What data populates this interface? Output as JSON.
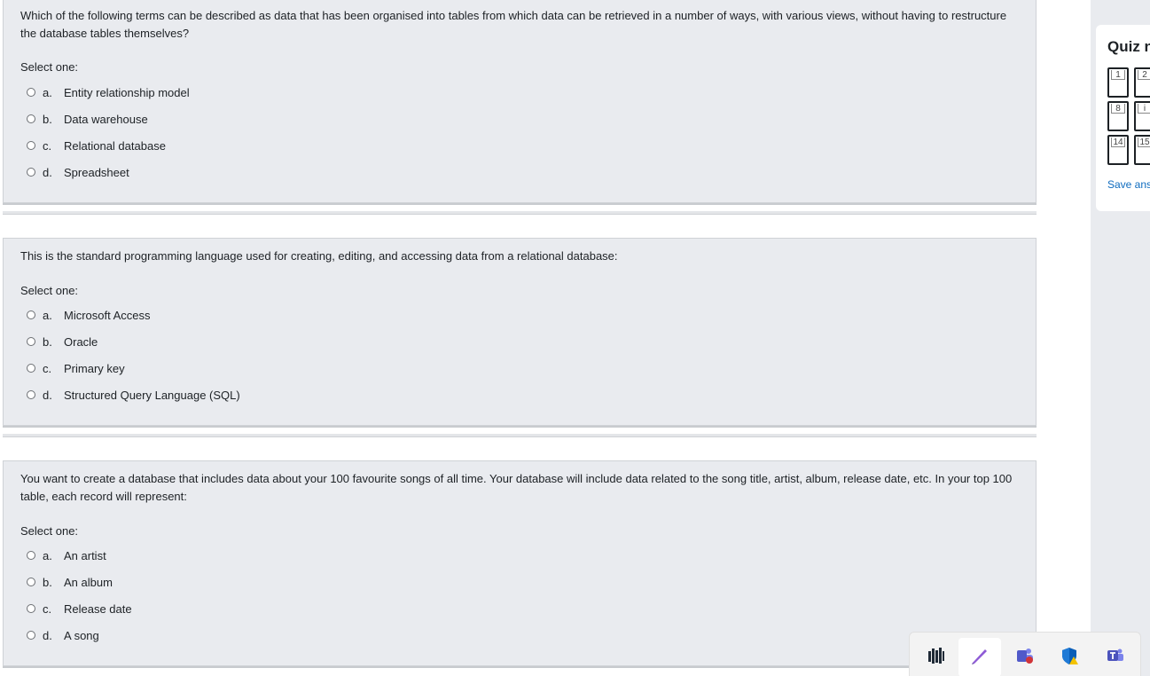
{
  "questions": [
    {
      "text": "Which of the following terms can be described as data that has been organised into tables from which data can be retrieved in a number of ways, with various views, without having to restructure the database tables themselves?",
      "prompt": "Select one:",
      "options": [
        {
          "letter": "a.",
          "label": "Entity relationship model"
        },
        {
          "letter": "b.",
          "label": "Data warehouse"
        },
        {
          "letter": "c.",
          "label": "Relational database"
        },
        {
          "letter": "d.",
          "label": "Spreadsheet"
        }
      ]
    },
    {
      "text": "This is the standard programming language used for creating, editing, and accessing data from a relational database:",
      "prompt": "Select one:",
      "options": [
        {
          "letter": "a.",
          "label": "Microsoft Access"
        },
        {
          "letter": "b.",
          "label": "Oracle"
        },
        {
          "letter": "c.",
          "label": "Primary key"
        },
        {
          "letter": "d.",
          "label": "Structured Query Language (SQL)"
        }
      ]
    },
    {
      "text": "You want to create a database that includes data about your 100 favourite songs of all time. Your database will include data related to the song title, artist, album, release date, etc. In your top 100 table, each record will represent:",
      "prompt": "Select one:",
      "options": [
        {
          "letter": "a.",
          "label": "An artist"
        },
        {
          "letter": "b.",
          "label": "An album"
        },
        {
          "letter": "c.",
          "label": "Release date"
        },
        {
          "letter": "d.",
          "label": "A song"
        }
      ]
    }
  ],
  "quiz_nav": {
    "title": "Quiz n",
    "buttons": [
      "1",
      "2",
      "8",
      "i",
      "14",
      "15"
    ],
    "save_link": "Save ans"
  },
  "taskbar": {
    "icons": [
      "bar-chart-app-icon",
      "pen-app-icon",
      "teams-people-icon",
      "security-shield-warning-icon",
      "teams-icon"
    ]
  }
}
